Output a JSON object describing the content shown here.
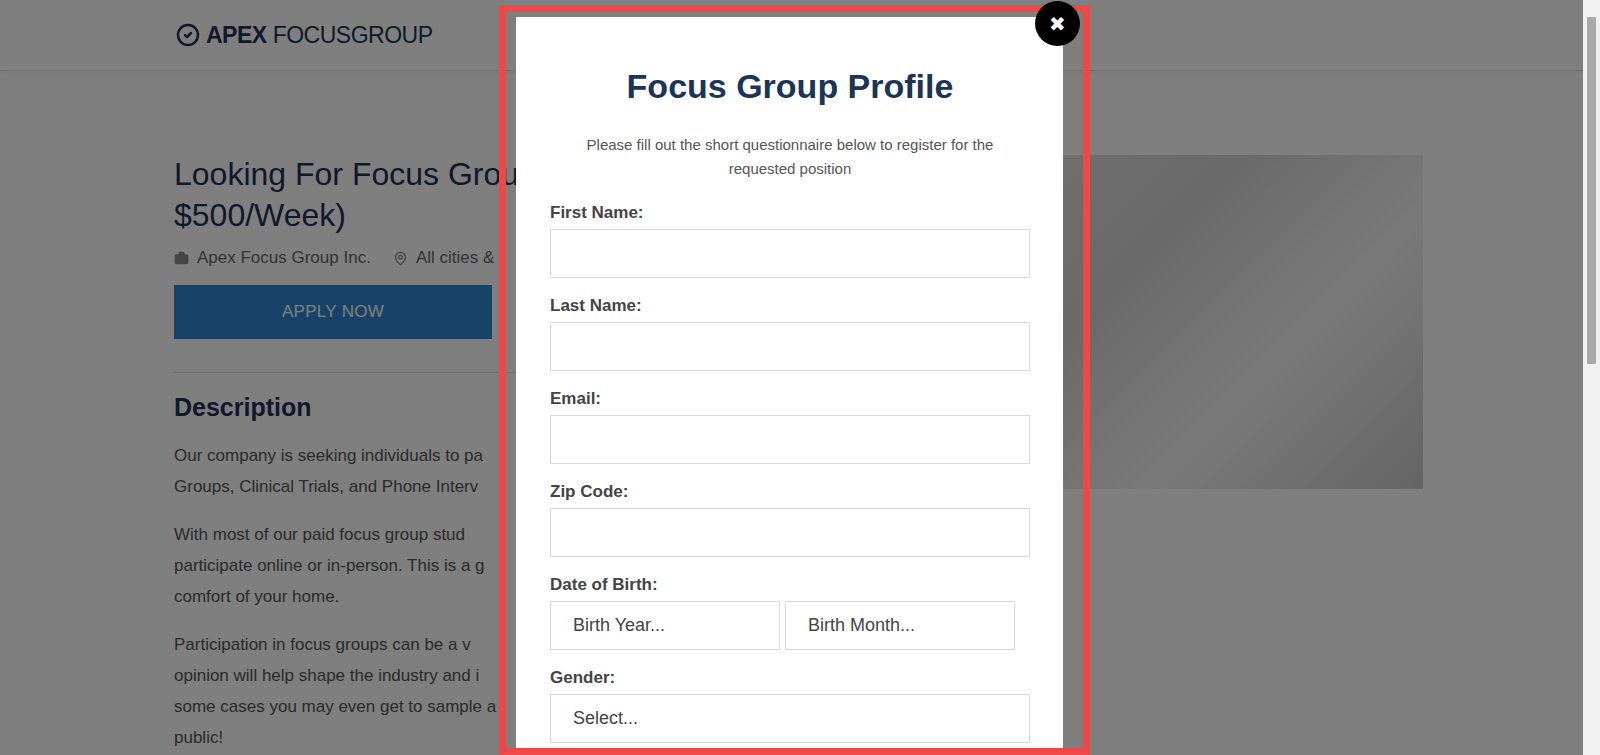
{
  "header": {
    "logo_bold": "APEX",
    "logo_light": "FOCUSGROUP"
  },
  "job": {
    "title_lines": [
      "Looking For Focus Grou",
      "$500/Week)"
    ],
    "company": "Apex Focus Group Inc.",
    "location": "All cities &",
    "apply": "APPLY NOW",
    "description_heading": "Description",
    "paragraphs": [
      [
        "Our company is seeking individuals to pa",
        "Groups, Clinical Trials, and Phone Interv"
      ],
      [
        "With most of our paid focus group stud",
        "participate online or in-person. This is a g",
        "comfort of your home."
      ],
      [
        "Participation in focus groups can be a v",
        "opinion will help shape the industry and i",
        "some cases you may even get to sample a",
        "public!"
      ]
    ]
  },
  "modal": {
    "close": "✖",
    "title": "Focus Group Profile",
    "subtitle_lines": [
      "Please fill out the short questionnaire below to register for the",
      "requested position"
    ],
    "fields": [
      {
        "label": "First Name:",
        "kind": "input",
        "placeholders": []
      },
      {
        "label": "Last Name:",
        "kind": "input",
        "placeholders": []
      },
      {
        "label": "Email:",
        "kind": "input",
        "placeholders": []
      },
      {
        "label": "Zip Code:",
        "kind": "input",
        "placeholders": []
      },
      {
        "label": "Date of Birth:",
        "kind": "select-pair",
        "placeholders": [
          "Birth Year...",
          "Birth Month..."
        ]
      },
      {
        "label": "Gender:",
        "kind": "select",
        "placeholders": [
          "Select..."
        ]
      }
    ]
  }
}
